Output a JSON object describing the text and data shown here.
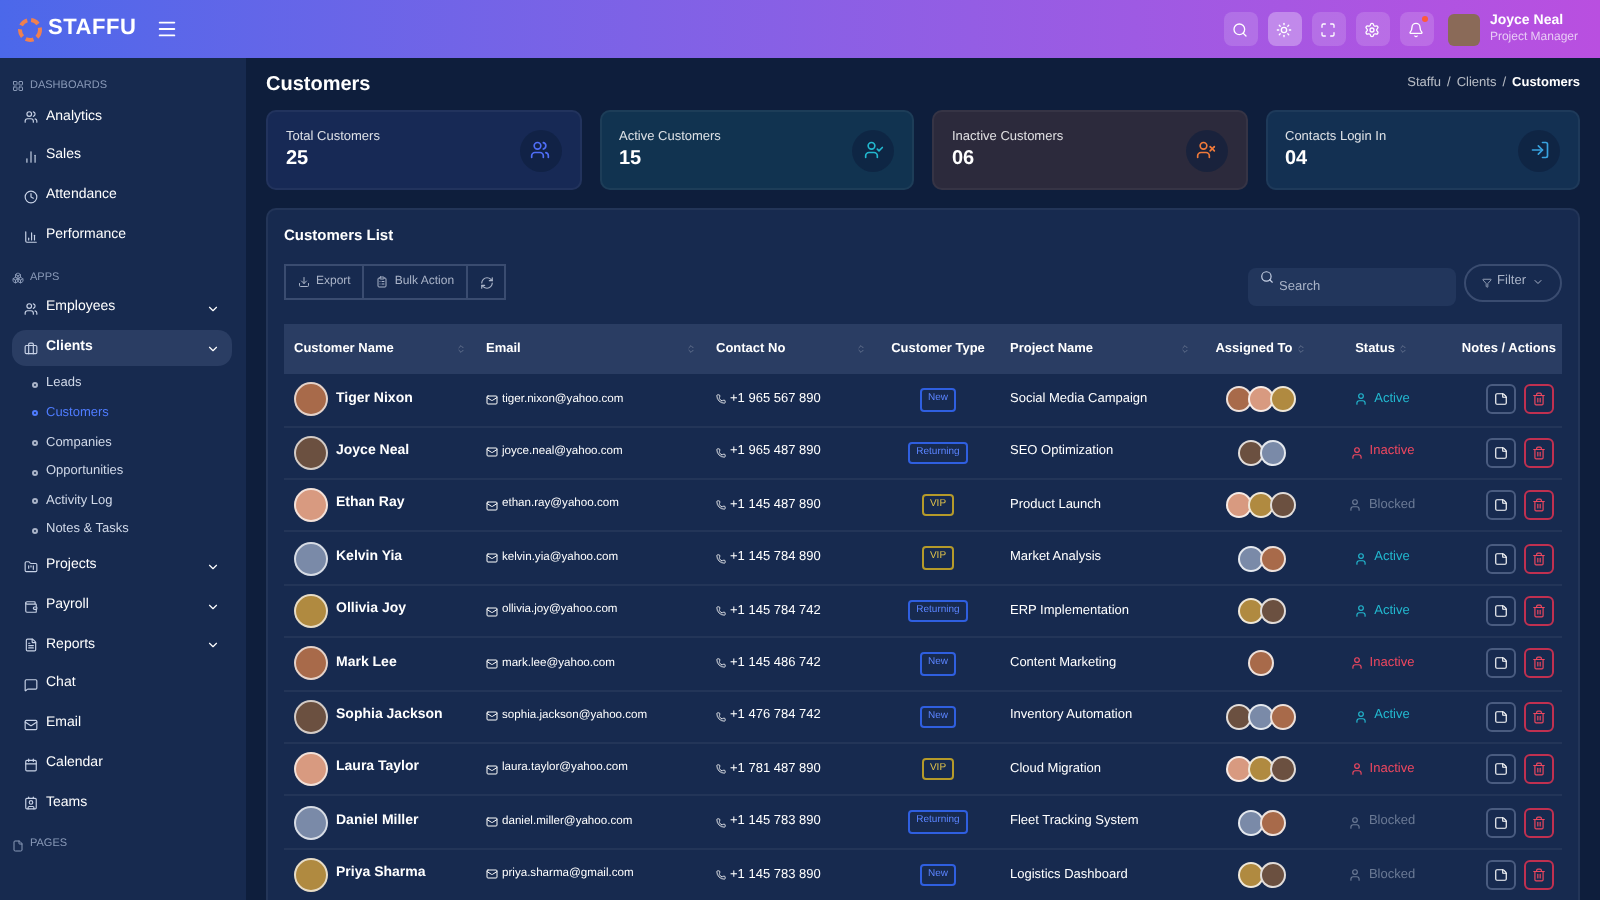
{
  "header": {
    "logo": "STAFFU",
    "user": {
      "name": "Joyce Neal",
      "role": "Project Manager"
    },
    "notifications_dot": true
  },
  "sidebar": {
    "sections": [
      {
        "title": "DASHBOARDS",
        "items": [
          {
            "label": "Analytics",
            "kind": "link",
            "selected": false
          },
          {
            "label": "Sales",
            "kind": "link",
            "selected": false
          },
          {
            "label": "Attendance",
            "kind": "link",
            "selected": false
          },
          {
            "label": "Performance",
            "kind": "link",
            "selected": false
          }
        ]
      },
      {
        "title": "APPS",
        "items": [
          {
            "label": "Employees",
            "kind": "group",
            "selected": false
          },
          {
            "label": "Clients",
            "kind": "group",
            "selected": true,
            "children": [
              {
                "label": "Leads",
                "selected": false
              },
              {
                "label": "Customers",
                "selected": true
              },
              {
                "label": "Companies",
                "selected": false
              },
              {
                "label": "Opportunities",
                "selected": false
              },
              {
                "label": "Activity Log",
                "selected": false
              },
              {
                "label": "Notes & Tasks",
                "selected": false
              }
            ]
          },
          {
            "label": "Projects",
            "kind": "group",
            "selected": false
          },
          {
            "label": "Payroll",
            "kind": "group",
            "selected": false
          },
          {
            "label": "Reports",
            "kind": "group",
            "selected": false
          },
          {
            "label": "Chat",
            "kind": "link",
            "selected": false
          },
          {
            "label": "Email",
            "kind": "link",
            "selected": false
          },
          {
            "label": "Calendar",
            "kind": "link",
            "selected": false
          },
          {
            "label": "Teams",
            "kind": "link",
            "selected": false
          }
        ]
      },
      {
        "title": "PAGES"
      }
    ]
  },
  "page": {
    "title": "Customers",
    "breadcrumbs": [
      {
        "kind": "link",
        "label": "Staffu"
      },
      {
        "kind": "separator",
        "label": "/"
      },
      {
        "kind": "link",
        "label": "Clients"
      },
      {
        "kind": "separator",
        "label": "/"
      },
      {
        "kind": "current",
        "label": "Customers"
      }
    ]
  },
  "stats": [
    {
      "label": "Total Customers",
      "value": "25",
      "color": "#4f6ef7"
    },
    {
      "label": "Active Customers",
      "value": "15",
      "color": "#22b8cf"
    },
    {
      "label": "Inactive Customers",
      "value": "06",
      "color": "#f07a3a"
    },
    {
      "label": "Contacts Login In",
      "value": "04",
      "color": "#38a3e0"
    }
  ],
  "list": {
    "title": "Customers List",
    "toolbar": [
      "Export",
      "Bulk Action"
    ],
    "search": {
      "placeholder": "Search"
    },
    "filter": "Filter",
    "columns": [
      "Customer Name",
      "Email",
      "Contact No",
      "Customer Type",
      "Project Name",
      "Assigned To",
      "Status",
      "Notes / Actions"
    ],
    "rows": [
      {
        "name": "Tiger Nixon",
        "email": "tiger.nixon@yahoo.com",
        "phone": "+1 965 567 890",
        "type": {
          "label": "New",
          "kind": "new"
        },
        "project": "Social Media Campaign",
        "assigned": [
          {
            "kind": "photo"
          },
          {
            "kind": "photo"
          },
          {
            "kind": "photo"
          }
        ],
        "status": {
          "label": "Active",
          "kind": "active"
        }
      },
      {
        "name": "Joyce Neal",
        "email": "joyce.neal@yahoo.com",
        "phone": "+1 965 487 890",
        "type": {
          "label": "Returning",
          "kind": "returning"
        },
        "project": "SEO Optimization",
        "assigned": [
          {
            "kind": "photo"
          },
          {
            "kind": "photo"
          }
        ],
        "status": {
          "label": "Inactive",
          "kind": "inactive"
        }
      },
      {
        "name": "Ethan Ray",
        "email": "ethan.ray@yahoo.com",
        "phone": "+1 145 487 890",
        "type": {
          "label": "VIP",
          "kind": "vip"
        },
        "project": "Product Launch",
        "assigned": [
          {
            "kind": "photo"
          },
          {
            "kind": "photo"
          },
          {
            "kind": "photo"
          }
        ],
        "status": {
          "label": "Blocked",
          "kind": "blocked"
        }
      },
      {
        "name": "Kelvin Yia",
        "email": "kelvin.yia@yahoo.com",
        "phone": "+1 145 784 890",
        "type": {
          "label": "VIP",
          "kind": "vip"
        },
        "project": "Market Analysis",
        "assigned": [
          {
            "kind": "photo"
          },
          {
            "kind": "photo"
          }
        ],
        "status": {
          "label": "Active",
          "kind": "active"
        }
      },
      {
        "name": "Ollivia Joy",
        "email": "ollivia.joy@yahoo.com",
        "phone": "+1 145 784 742",
        "type": {
          "label": "Returning",
          "kind": "returning"
        },
        "project": "ERP Implementation",
        "assigned": [
          {
            "kind": "photo"
          },
          {
            "kind": "photo"
          }
        ],
        "status": {
          "label": "Active",
          "kind": "active"
        }
      },
      {
        "name": "Mark Lee",
        "email": "mark.lee@yahoo.com",
        "phone": "+1 145 486 742",
        "type": {
          "label": "New",
          "kind": "new"
        },
        "project": "Content Marketing",
        "assigned": [
          {
            "kind": "photo"
          }
        ],
        "status": {
          "label": "Inactive",
          "kind": "inactive"
        }
      },
      {
        "name": "Sophia Jackson",
        "email": "sophia.jackson@yahoo.com",
        "phone": "+1 476 784 742",
        "type": {
          "label": "New",
          "kind": "new"
        },
        "project": "Inventory Automation",
        "assigned": [
          {
            "kind": "photo"
          },
          {
            "kind": "photo"
          },
          {
            "kind": "photo"
          }
        ],
        "status": {
          "label": "Active",
          "kind": "active"
        }
      },
      {
        "name": "Laura Taylor",
        "email": "laura.taylor@yahoo.com",
        "phone": "+1 781 487 890",
        "type": {
          "label": "VIP",
          "kind": "vip"
        },
        "project": "Cloud Migration",
        "assigned": [
          {
            "kind": "photo"
          },
          {
            "kind": "photo"
          },
          {
            "kind": "photo"
          }
        ],
        "status": {
          "label": "Inactive",
          "kind": "inactive"
        }
      },
      {
        "name": "Daniel Miller",
        "email": "daniel.miller@yahoo.com",
        "phone": "+1 145 783 890",
        "type": {
          "label": "Returning",
          "kind": "returning"
        },
        "project": "Fleet Tracking System",
        "assigned": [
          {
            "kind": "photo"
          },
          {
            "kind": "photo"
          }
        ],
        "status": {
          "label": "Blocked",
          "kind": "blocked"
        }
      },
      {
        "name": "Priya Sharma",
        "email": "priya.sharma@gmail.com",
        "phone": "+1 145 783 890",
        "type": {
          "label": "New",
          "kind": "new"
        },
        "project": "Logistics Dashboard",
        "assigned": [
          {
            "kind": "photo"
          },
          {
            "kind": "photo"
          }
        ],
        "status": {
          "label": "Blocked",
          "kind": "blocked"
        }
      }
    ]
  }
}
